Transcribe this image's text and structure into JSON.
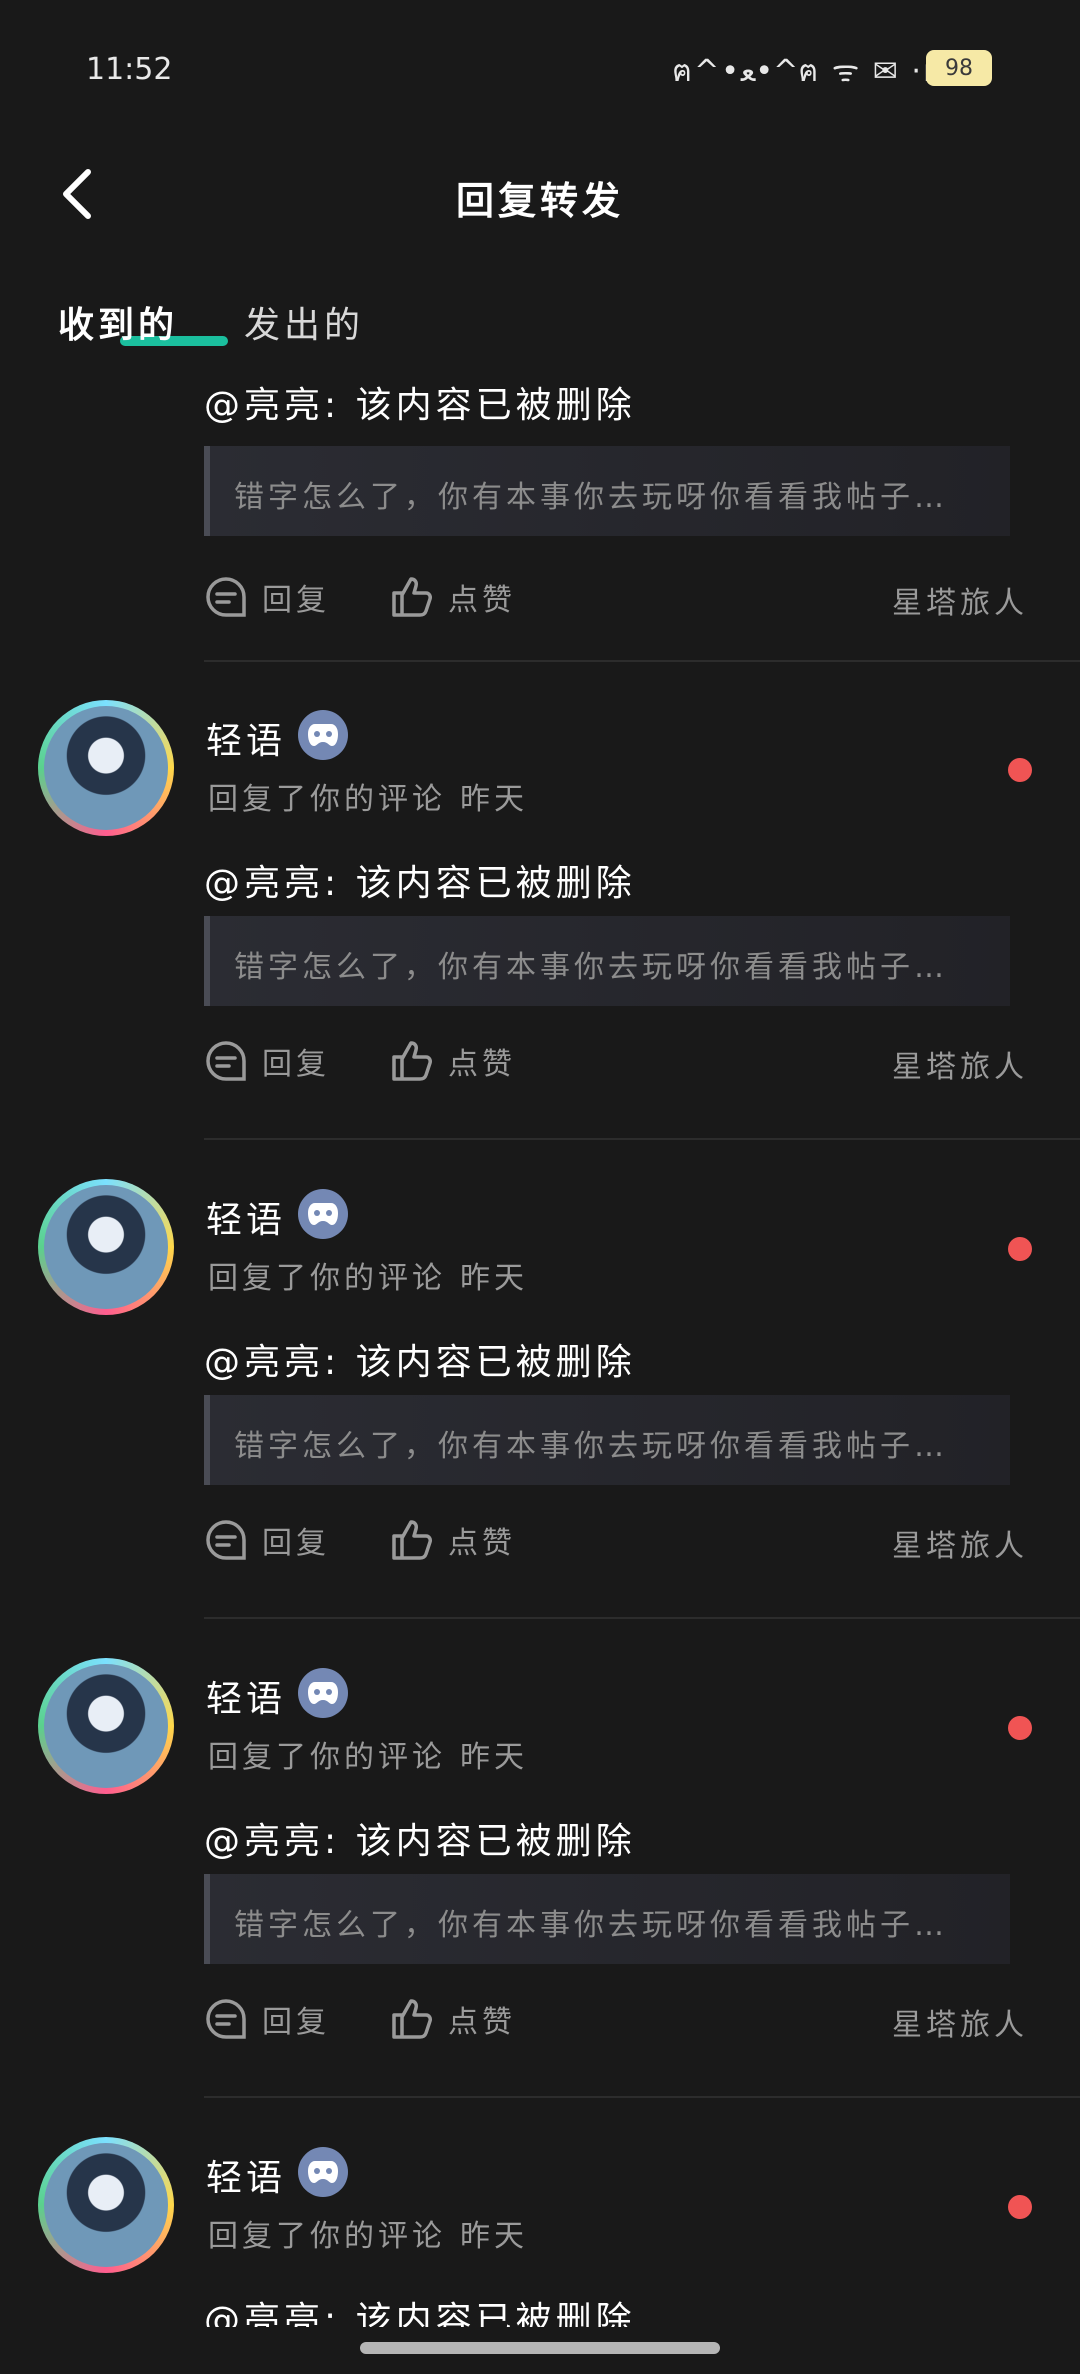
{
  "status_bar": {
    "time": "11:52",
    "icons_text": "ฅ^•ﻌ•^ฅ ᯤ ✉ ·ıl",
    "battery": "98"
  },
  "header": {
    "title": "回复转发"
  },
  "tabs": [
    {
      "label": "收到的",
      "active": true
    },
    {
      "label": "发出的",
      "active": false
    }
  ],
  "items": [
    {
      "user": "",
      "meta": "",
      "time": "",
      "unread": false,
      "mention": "@亮亮: 该内容已被删除",
      "quote": "错字怎么了，你有本事你去玩呀你看看我帖子…",
      "reply_label": "回复",
      "like_label": "点赞",
      "source": "星塔旅人"
    },
    {
      "user": "轻语",
      "meta": "回复了你的评论",
      "time": "昨天",
      "unread": true,
      "mention": "@亮亮: 该内容已被删除",
      "quote": "错字怎么了，你有本事你去玩呀你看看我帖子…",
      "reply_label": "回复",
      "like_label": "点赞",
      "source": "星塔旅人"
    },
    {
      "user": "轻语",
      "meta": "回复了你的评论",
      "time": "昨天",
      "unread": true,
      "mention": "@亮亮: 该内容已被删除",
      "quote": "错字怎么了，你有本事你去玩呀你看看我帖子…",
      "reply_label": "回复",
      "like_label": "点赞",
      "source": "星塔旅人"
    },
    {
      "user": "轻语",
      "meta": "回复了你的评论",
      "time": "昨天",
      "unread": true,
      "mention": "@亮亮: 该内容已被删除",
      "quote": "错字怎么了，你有本事你去玩呀你看看我帖子…",
      "reply_label": "回复",
      "like_label": "点赞",
      "source": "星塔旅人"
    },
    {
      "user": "轻语",
      "meta": "回复了你的评论",
      "time": "昨天",
      "unread": true,
      "mention": "@亮亮: 该内容已被删除",
      "quote": "",
      "reply_label": "",
      "like_label": "",
      "source": ""
    }
  ],
  "colors": {
    "background": "#191919",
    "accent": "#1bbf9e",
    "unread": "#f05454",
    "badge": "#7488b4"
  }
}
